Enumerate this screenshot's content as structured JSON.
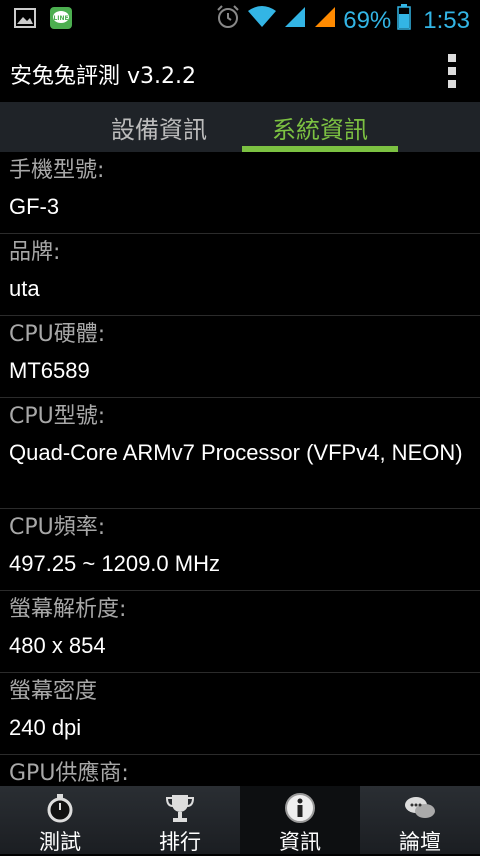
{
  "status_bar": {
    "battery_percent": "69%",
    "time": "1:53",
    "icons": [
      "gallery-icon",
      "line-app-icon",
      "alarm-icon",
      "wifi-icon",
      "signal-icon",
      "signal-icon",
      "battery-icon"
    ]
  },
  "action_bar": {
    "title": "安兔兔評測 v3.2.2"
  },
  "tabs": [
    {
      "label": "設備資訊"
    },
    {
      "label": "系統資訊"
    }
  ],
  "info_rows": [
    {
      "label": "手機型號:",
      "value": "GF-3"
    },
    {
      "label": "品牌:",
      "value": "uta"
    },
    {
      "label": "CPU硬體:",
      "value": "MT6589"
    },
    {
      "label": "CPU型號:",
      "value": "Quad-Core ARMv7 Processor (VFPv4, NEON)"
    },
    {
      "label": "CPU頻率:",
      "value": "497.25 ~ 1209.0 MHz"
    },
    {
      "label": "螢幕解析度:",
      "value": "480 x 854"
    },
    {
      "label": "螢幕密度",
      "value": "240 dpi"
    },
    {
      "label": "GPU供應商:",
      "value": ""
    }
  ],
  "bottom_nav": [
    {
      "label": "測試",
      "icon": "stopwatch-icon"
    },
    {
      "label": "排行",
      "icon": "trophy-icon"
    },
    {
      "label": "資訊",
      "icon": "info-icon"
    },
    {
      "label": "論壇",
      "icon": "chat-bubbles-icon"
    }
  ],
  "colors": {
    "accent_green": "#7cc142",
    "status_blue": "#33b5e5",
    "signal_orange": "#ff8a00"
  }
}
